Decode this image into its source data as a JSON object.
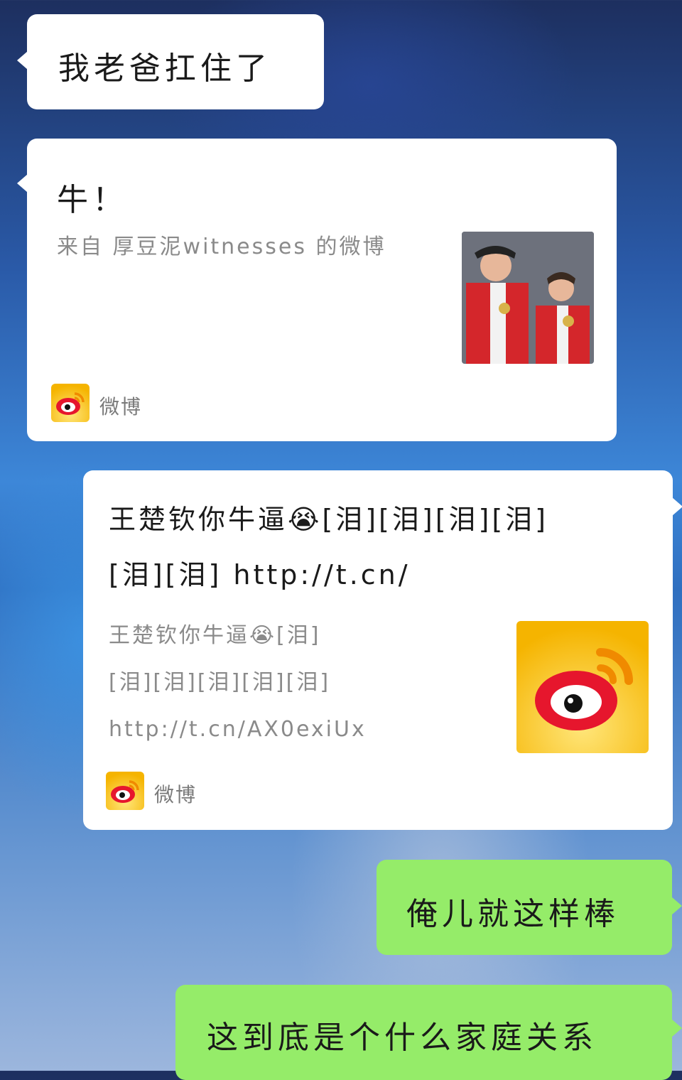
{
  "messages": {
    "m1": {
      "text": "我老爸扛住了"
    },
    "m2": {
      "text": "牛！",
      "share_desc": "来自 厚豆泥witnesses 的微博",
      "source": "微博",
      "thumb_icon": "photo-icon"
    },
    "m3": {
      "title_line1": "王楚钦你牛逼😭[泪][泪][泪][泪]",
      "title_line2": "[泪][泪] http://t.cn/",
      "desc_line1": "王楚钦你牛逼😭[泪]",
      "desc_line2": "[泪][泪][泪][泪][泪]",
      "desc_line3": "http://t.cn/AX0exiUx",
      "source": "微博",
      "thumb_icon": "weibo-logo-icon"
    },
    "m4": {
      "text": "俺儿就这样棒"
    },
    "m5": {
      "text": "这到底是个什么家庭关系"
    }
  },
  "colors": {
    "incoming_bubble": "#ffffff",
    "outgoing_bubble": "#95ec69",
    "weibo_yellow": "#f5b400",
    "weibo_red": "#e6162d"
  }
}
